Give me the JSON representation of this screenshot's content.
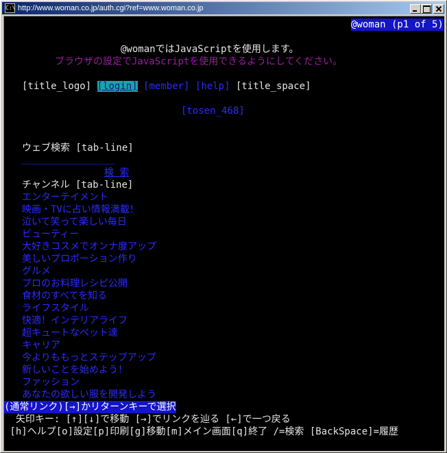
{
  "window": {
    "title": "http://www.woman.co.jp/auth.cgi?ref=www.woman.co.jp",
    "system_icon_text": "C:\\"
  },
  "status": "@woman (p1 of 5)",
  "notice": {
    "line1": "@womanではJavaScriptを使用します。",
    "line2": "ブラウザの設定でJavaScriptを使用できるようにしてください。"
  },
  "nav": {
    "title_logo": "[title_logo]",
    "login": "[login]",
    "member": "[member]",
    "help": "[help]",
    "title_space": "[title_space]"
  },
  "tosen": "[tosen_468]",
  "search": {
    "heading": "ウェブ検索 [tab-line]",
    "input_value": "________________",
    "button": "検 索"
  },
  "channel": {
    "heading": "チャンネル [tab-line]",
    "items": [
      "エンターテイメント",
      "映画・TVに占い情報満載！",
      "泣いて笑って楽しい毎日",
      "ビューティー",
      "大好きコスメでオンナ度アップ",
      "美しいプロポーション作り",
      "グルメ",
      "プロのお料理レシピ公開",
      "食材のすべてを知る",
      "ライフスタイル",
      "快適！インテリアライフ",
      "超キュートなペット達",
      "キャリア",
      "今よりももっとステップアップ",
      "新しいことを始めよう！",
      "ファッション",
      "あなたの欲しい服を開発しよう"
    ]
  },
  "footer": {
    "hint": "(通常リンク)[→]かリターンキーで選択",
    "keys1": "  矢印キー: [↑][↓]で移動 [→]でリンクを辿る [←]で一つ戻る",
    "keys2": " [h]ヘルプ[o]設定[p]印刷[g]移動[m]メイン画面[q]終了 /=検索 [BackSpace]=履歴"
  }
}
